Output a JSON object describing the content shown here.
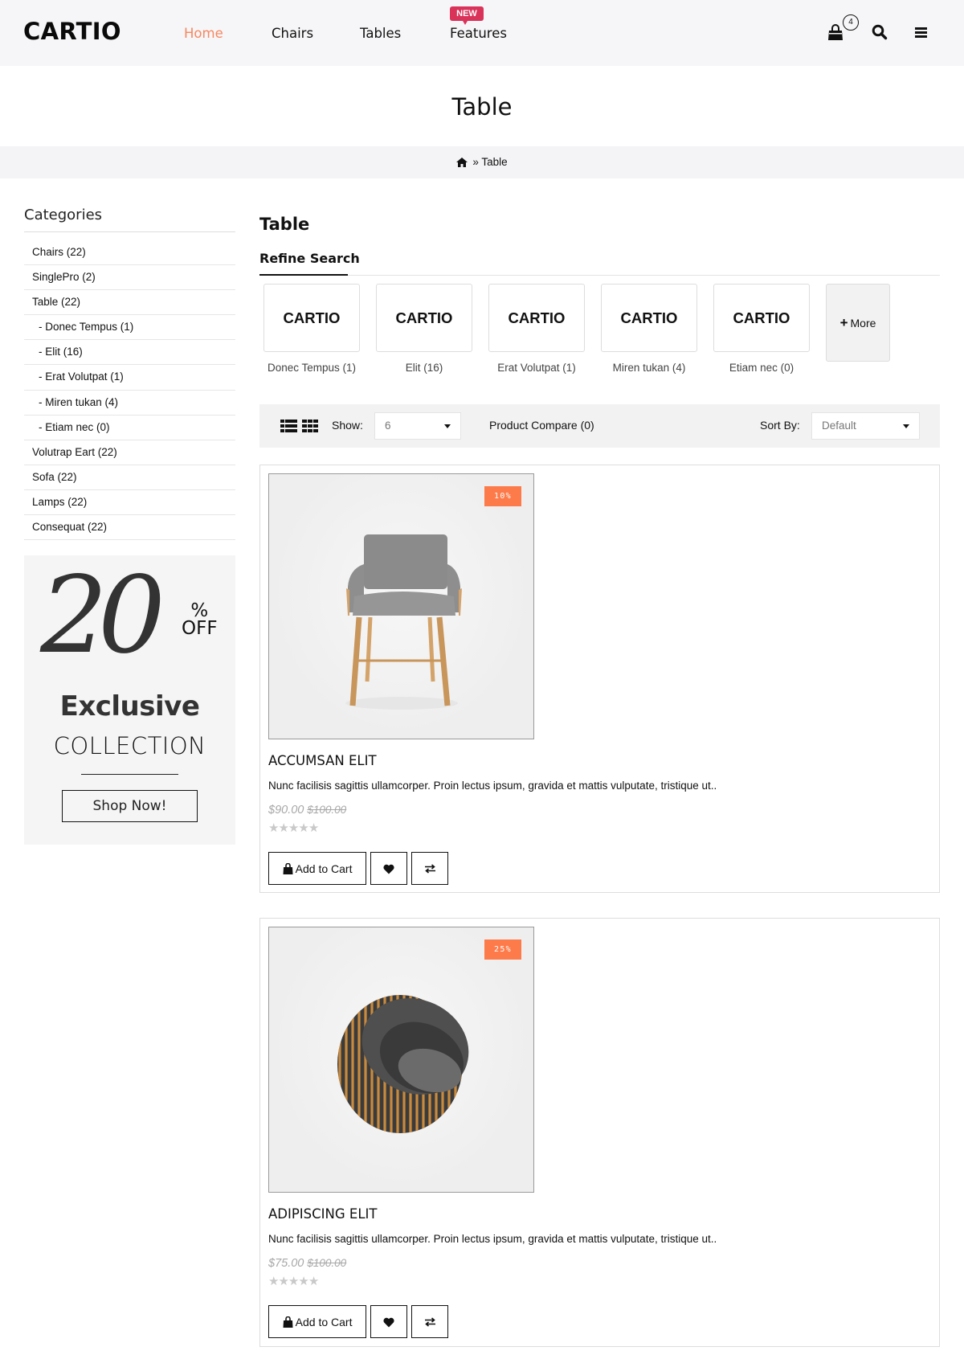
{
  "header": {
    "logo": "CARTIO",
    "nav": [
      {
        "label": "Home",
        "active": true
      },
      {
        "label": "Chairs",
        "active": false
      },
      {
        "label": "Tables",
        "active": false
      },
      {
        "label": "Features",
        "active": false,
        "badge": "NEW"
      }
    ],
    "cart_count": "4",
    "icons": [
      "shopping-bag-icon",
      "search-icon",
      "menu-icon"
    ],
    "accent_color": "#f7875f",
    "badge_color": "#d9335a"
  },
  "page": {
    "title": "Table",
    "breadcrumb": {
      "separator": "»",
      "current": "Table"
    }
  },
  "sidebar": {
    "heading": "Categories",
    "categories": [
      {
        "label": "Chairs (22)",
        "sub": false
      },
      {
        "label": "SinglePro (2)",
        "sub": false
      },
      {
        "label": "Table (22)",
        "sub": false
      },
      {
        "label": "- Donec Tempus (1)",
        "sub": true
      },
      {
        "label": "- Elit (16)",
        "sub": true
      },
      {
        "label": "- Erat Volutpat (1)",
        "sub": true
      },
      {
        "label": "- Miren tukan (4)",
        "sub": true
      },
      {
        "label": "- Etiam nec (0)",
        "sub": true
      },
      {
        "label": "Volutrap Eart (22)",
        "sub": false
      },
      {
        "label": "Sofa (22)",
        "sub": false
      },
      {
        "label": "Lamps (22)",
        "sub": false
      },
      {
        "label": "Consequat (22)",
        "sub": false
      }
    ],
    "promo": {
      "big_number": "20",
      "percent": "%",
      "off": "OFF",
      "headline": "Exclusive",
      "subline": "COLLECTION",
      "button": "Shop Now!"
    }
  },
  "main": {
    "title": "Table",
    "refine_label": "Refine Search",
    "brands": [
      {
        "logo": "CARTIO",
        "label": "Donec Tempus (1)"
      },
      {
        "logo": "CARTIO",
        "label": "Elit (16)"
      },
      {
        "logo": "CARTIO",
        "label": "Erat Volutpat (1)"
      },
      {
        "logo": "CARTIO",
        "label": "Miren tukan (4)"
      },
      {
        "logo": "CARTIO",
        "label": "Etiam nec (0)"
      }
    ],
    "more_label": "More",
    "toolbar": {
      "show_label": "Show:",
      "show_value": "6",
      "compare_label": "Product Compare (0)",
      "sort_label": "Sort By:",
      "sort_value": "Default"
    },
    "products": [
      {
        "name": "ACCUMSAN ELIT",
        "description": "Nunc facilisis sagittis ullamcorper. Proin lectus ipsum, gravida et mattis vulputate, tristique ut..",
        "price": "$90.00",
        "old_price": "$100.00",
        "discount": "10%",
        "rating": 0,
        "rating_max": 5,
        "add_to_cart": "Add to Cart"
      },
      {
        "name": "ADIPISCING ELIT",
        "description": "Nunc facilisis sagittis ullamcorper. Proin lectus ipsum, gravida et mattis vulputate, tristique ut..",
        "price": "$75.00",
        "old_price": "$100.00",
        "discount": "25%",
        "rating": 0,
        "rating_max": 5,
        "add_to_cart": "Add to Cart"
      }
    ],
    "discount_color": "#fd7b4a"
  }
}
